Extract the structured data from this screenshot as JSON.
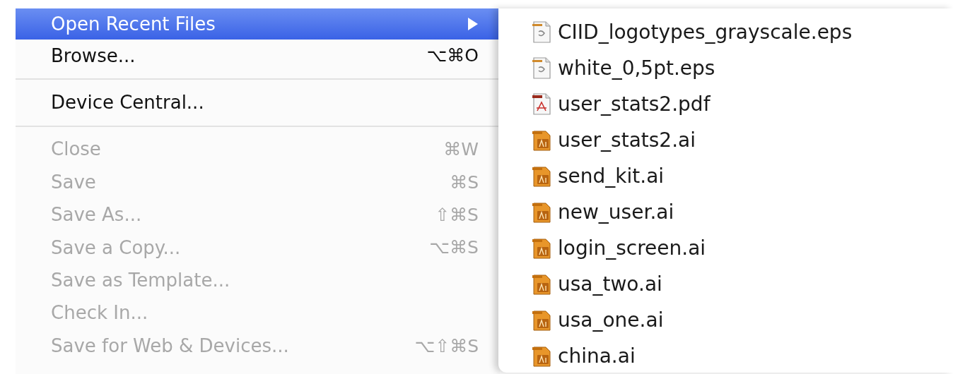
{
  "menu": {
    "items": [
      {
        "kind": "item",
        "label": "Open Recent Files",
        "arrow": true,
        "selected": true,
        "disabled": false
      },
      {
        "kind": "item",
        "label": "Browse...",
        "shortcut": "⌥⌘O",
        "arrow": false,
        "selected": false,
        "disabled": false
      },
      {
        "kind": "separator"
      },
      {
        "kind": "item",
        "label": "Device Central...",
        "arrow": false,
        "selected": false,
        "disabled": false
      },
      {
        "kind": "separator"
      },
      {
        "kind": "item",
        "label": "Close",
        "shortcut": "⌘W",
        "arrow": false,
        "selected": false,
        "disabled": true
      },
      {
        "kind": "item",
        "label": "Save",
        "shortcut": "⌘S",
        "arrow": false,
        "selected": false,
        "disabled": true
      },
      {
        "kind": "item",
        "label": "Save As...",
        "shortcut": "⇧⌘S",
        "arrow": false,
        "selected": false,
        "disabled": true
      },
      {
        "kind": "item",
        "label": "Save a Copy...",
        "shortcut": "⌥⌘S",
        "arrow": false,
        "selected": false,
        "disabled": true
      },
      {
        "kind": "item",
        "label": "Save as Template...",
        "arrow": false,
        "selected": false,
        "disabled": true
      },
      {
        "kind": "item",
        "label": "Check In...",
        "arrow": false,
        "selected": false,
        "disabled": true
      },
      {
        "kind": "item",
        "label": "Save for Web & Devices...",
        "shortcut": "⌥⇧⌘S",
        "arrow": false,
        "selected": false,
        "disabled": true
      }
    ]
  },
  "recent_files": [
    {
      "kind": "eps",
      "name": "CIID_logotypes_grayscale.eps"
    },
    {
      "kind": "eps",
      "name": "white_0,5pt.eps"
    },
    {
      "kind": "pdf",
      "name": "user_stats2.pdf"
    },
    {
      "kind": "ai",
      "name": "user_stats2.ai"
    },
    {
      "kind": "ai",
      "name": "send_kit.ai"
    },
    {
      "kind": "ai",
      "name": "new_user.ai"
    },
    {
      "kind": "ai",
      "name": "login_screen.ai"
    },
    {
      "kind": "ai",
      "name": "usa_two.ai"
    },
    {
      "kind": "ai",
      "name": "usa_one.ai"
    },
    {
      "kind": "ai",
      "name": "china.ai"
    }
  ]
}
